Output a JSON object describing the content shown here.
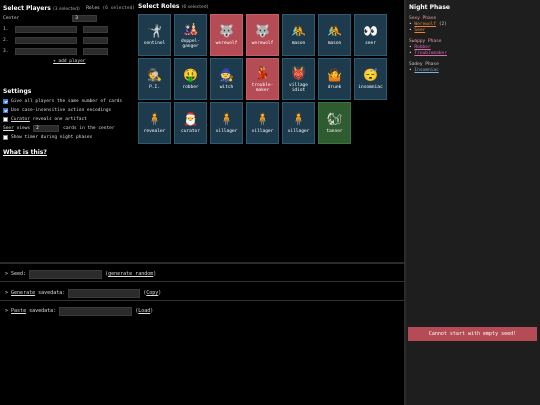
{
  "players": {
    "heading": "Select Players",
    "count": "(3 selected)",
    "roles_heading": "Roles",
    "roles_count": "(6 selected)",
    "center_label": "Center",
    "center_value": "3",
    "rows": [
      {
        "label": "1."
      },
      {
        "label": "2."
      },
      {
        "label": "3."
      }
    ],
    "add_player": "+ add player"
  },
  "settings": {
    "heading": "Settings",
    "opt1": "Give all players the same number of cards",
    "opt2": "Use case-insensitive action encodings",
    "opt3_link": "Curator",
    "opt3_rest": "reveals one artifact",
    "seer_link": "Seer",
    "seer_pre": "views",
    "seer_value": "2",
    "seer_post": "cards in the center",
    "opt5": "Show timer during night phases",
    "opt1_on": true,
    "opt2_on": true,
    "opt3_on": false,
    "opt5_on": false
  },
  "what_is_this": "What is this?",
  "roles": {
    "heading": "Select Roles",
    "count": "(6 selected)",
    "cards": [
      {
        "name": "sentinel",
        "icon": "🤺",
        "state": "normal"
      },
      {
        "name": "doppel-\nganger",
        "icon": "🎎",
        "state": "normal"
      },
      {
        "name": "werewolf",
        "icon": "🐺",
        "state": "selected"
      },
      {
        "name": "werewolf",
        "icon": "🐺",
        "state": "selected"
      },
      {
        "name": "mason",
        "icon": "🤼",
        "state": "normal"
      },
      {
        "name": "mason",
        "icon": "🤼",
        "state": "normal"
      },
      {
        "name": "seer",
        "icon": "👀",
        "state": "normal"
      },
      {
        "name": "P.I.",
        "icon": "🕵",
        "state": "normal"
      },
      {
        "name": "robber",
        "icon": "🤑",
        "state": "normal"
      },
      {
        "name": "witch",
        "icon": "🧙",
        "state": "normal"
      },
      {
        "name": "trouble-\nmaker",
        "icon": "💃",
        "state": "selected"
      },
      {
        "name": "village\nidiot",
        "icon": "👹",
        "state": "normal"
      },
      {
        "name": "drunk",
        "icon": "🤷",
        "state": "normal"
      },
      {
        "name": "insomniac",
        "icon": "😴",
        "state": "normal"
      },
      {
        "name": "revealer",
        "icon": "🧍",
        "state": "normal"
      },
      {
        "name": "curator",
        "icon": "🎅",
        "state": "normal"
      },
      {
        "name": "villager",
        "icon": "🧍",
        "state": "normal"
      },
      {
        "name": "villager",
        "icon": "🧍",
        "state": "normal"
      },
      {
        "name": "villager",
        "icon": "🧍",
        "state": "normal"
      },
      {
        "name": "tanner",
        "icon": "🐿",
        "state": "tanner"
      }
    ]
  },
  "night": {
    "heading": "Night Phase",
    "groups": [
      {
        "title": "Sexy Phase",
        "color": "#e8a0a6",
        "items": [
          {
            "text": "Werewolf",
            "suffix": " (2)",
            "color": "#e8823c"
          },
          {
            "text": "Seer",
            "suffix": "",
            "color": "#e8823c"
          }
        ]
      },
      {
        "title": "Swappy Phase",
        "color": "#e8a0a6",
        "items": [
          {
            "text": "Robber",
            "suffix": "",
            "color": "#d96ab0"
          },
          {
            "text": "Troublemaker",
            "suffix": "",
            "color": "#d96ab0"
          }
        ]
      },
      {
        "title": "Sadey Phase",
        "color": "#c8c8c8",
        "items": [
          {
            "text": "Insomniac",
            "suffix": "",
            "color": "#7fb0d8"
          }
        ]
      }
    ],
    "error": "Cannot start with empty seed!"
  },
  "bottom": {
    "seed_label": "> Seed:",
    "seed_link": "generate random",
    "generate_pre": ">",
    "generate_link": "Generate",
    "generate_post": "savedata:",
    "copy": "Copy",
    "paste_pre": ">",
    "paste_link": "Paste",
    "paste_post": "savedata:",
    "load": "Load"
  },
  "colors": {
    "selected": "#b54b55",
    "card": "#1d3b4c",
    "tanner": "#2f5b30"
  }
}
